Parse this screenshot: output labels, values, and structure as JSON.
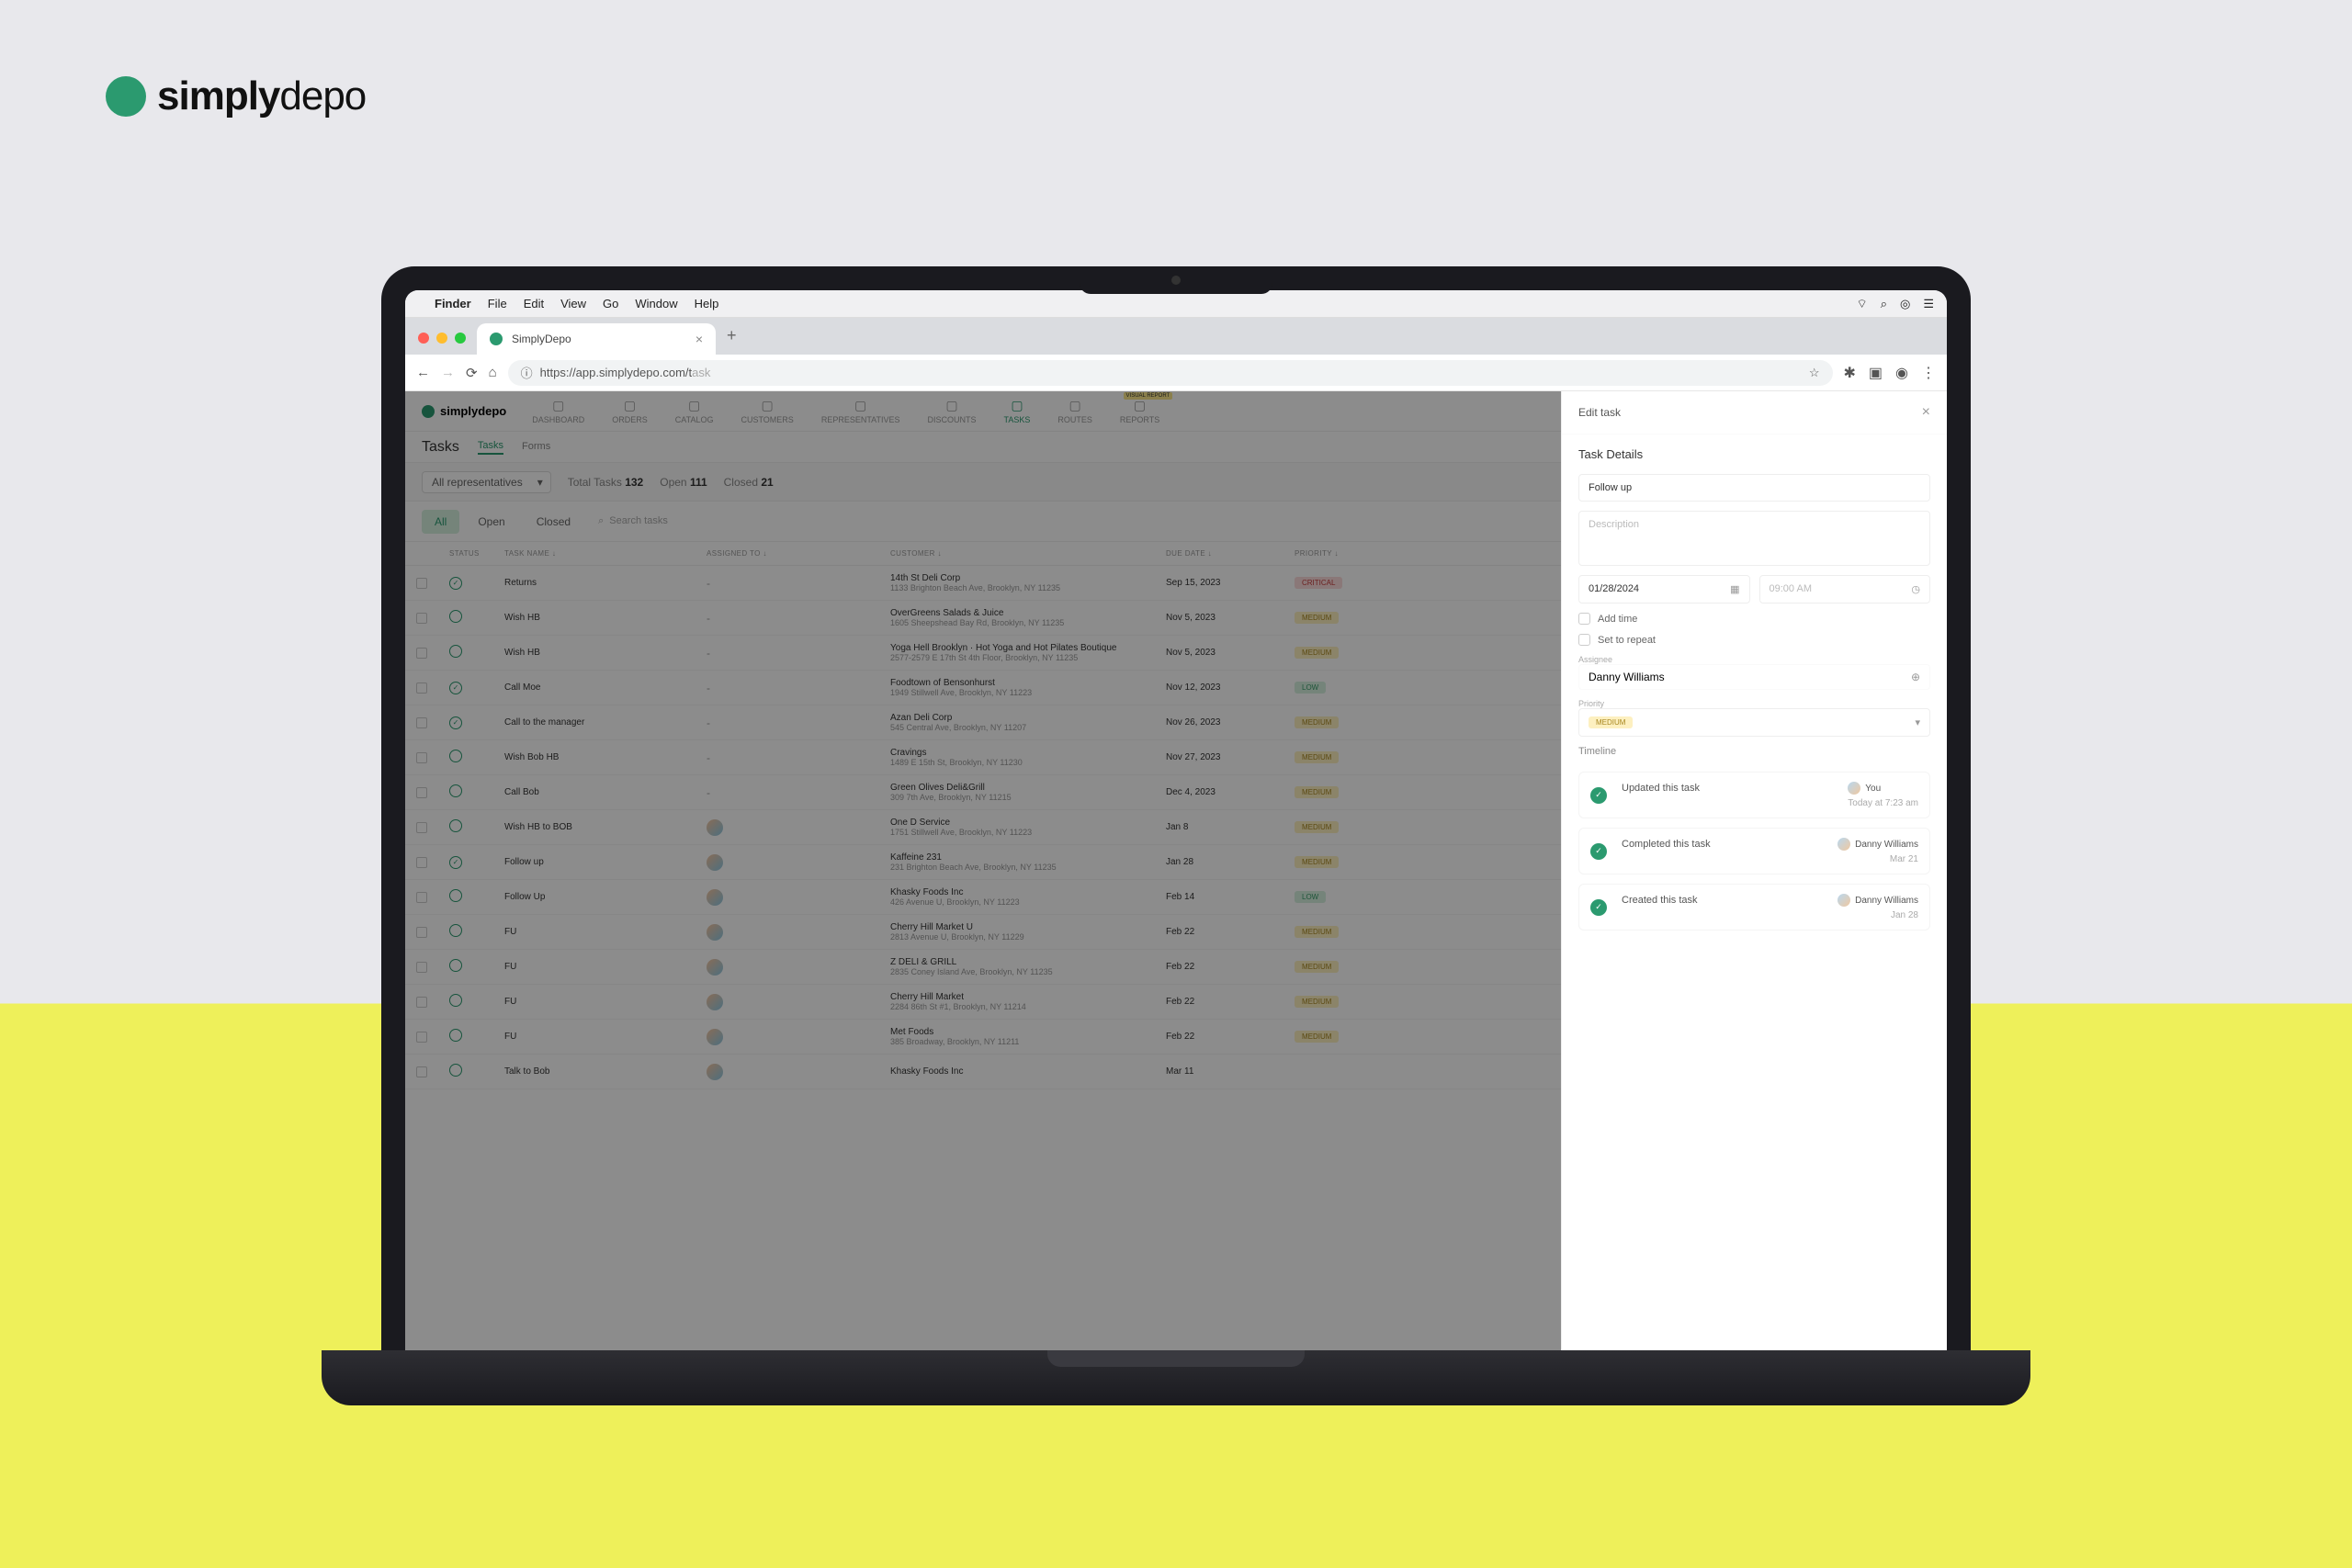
{
  "brand": {
    "text_bold": "simply",
    "text_light": "depo"
  },
  "mac_menubar": {
    "items": [
      "Finder",
      "File",
      "Edit",
      "View",
      "Go",
      "Window",
      "Help"
    ]
  },
  "chrome": {
    "tab_title": "SimplyDepo",
    "url_display": "https://app.simplydepo.com/t",
    "url_grey": "ask"
  },
  "app": {
    "nav": [
      {
        "label": "DASHBOARD",
        "active": false
      },
      {
        "label": "ORDERS",
        "active": false
      },
      {
        "label": "CATALOG",
        "active": false
      },
      {
        "label": "CUSTOMERS",
        "active": false
      },
      {
        "label": "REPRESENTATIVES",
        "active": false
      },
      {
        "label": "DISCOUNTS",
        "active": false
      },
      {
        "label": "TASKS",
        "active": true
      },
      {
        "label": "ROUTES",
        "active": false
      },
      {
        "label": "REPORTS",
        "active": false,
        "badge": "VISUAL REPORT"
      }
    ],
    "page_title": "Tasks",
    "subtabs": [
      "Tasks",
      "Forms"
    ],
    "subtab_active": 0,
    "filters": {
      "rep_select": "All representatives",
      "total_label": "Total Tasks",
      "total_value": "132",
      "open_label": "Open",
      "open_value": "111",
      "closed_label": "Closed",
      "closed_value": "21"
    },
    "toolbar": {
      "tabs": [
        "All",
        "Open",
        "Closed"
      ],
      "active": 0,
      "search_placeholder": "Search tasks"
    },
    "columns": [
      "",
      "STATUS",
      "TASK NAME ↓",
      "ASSIGNED TO ↓",
      "CUSTOMER ↓",
      "DUE DATE ↓",
      "PRIORITY ↓"
    ],
    "rows": [
      {
        "status_done": true,
        "task": "Returns",
        "assigned": "-",
        "customer": "14th St Deli Corp",
        "addr": "1133 Brighton Beach Ave, Brooklyn, NY 11235",
        "due": "Sep 15, 2023",
        "priority": "CRITICAL",
        "pc": "critical"
      },
      {
        "status_done": false,
        "task": "Wish HB",
        "assigned": "-",
        "customer": "OverGreens Salads & Juice",
        "addr": "1605 Sheepshead Bay Rd, Brooklyn, NY 11235",
        "due": "Nov 5, 2023",
        "priority": "MEDIUM",
        "pc": "medium"
      },
      {
        "status_done": false,
        "task": "Wish HB",
        "assigned": "-",
        "customer": "Yoga Hell Brooklyn · Hot Yoga and Hot Pilates Boutique",
        "addr": "2577-2579 E 17th St 4th Floor, Brooklyn, NY 11235",
        "due": "Nov 5, 2023",
        "priority": "MEDIUM",
        "pc": "medium"
      },
      {
        "status_done": true,
        "task": "Call Moe",
        "assigned": "-",
        "customer": "Foodtown of Bensonhurst",
        "addr": "1949 Stillwell Ave, Brooklyn, NY 11223",
        "due": "Nov 12, 2023",
        "priority": "LOW",
        "pc": "low"
      },
      {
        "status_done": true,
        "task": "Call to the manager",
        "assigned": "-",
        "customer": "Azan Deli Corp",
        "addr": "545 Central Ave, Brooklyn, NY 11207",
        "due": "Nov 26, 2023",
        "priority": "MEDIUM",
        "pc": "medium"
      },
      {
        "status_done": false,
        "task": "Wish Bob HB",
        "assigned": "-",
        "customer": "Cravings",
        "addr": "1489 E 15th St, Brooklyn, NY 11230",
        "due": "Nov 27, 2023",
        "priority": "MEDIUM",
        "pc": "medium"
      },
      {
        "status_done": false,
        "task": "Call Bob",
        "assigned": "-",
        "customer": "Green Olives Deli&Grill",
        "addr": "309 7th Ave, Brooklyn, NY 11215",
        "due": "Dec 4, 2023",
        "priority": "MEDIUM",
        "pc": "medium"
      },
      {
        "status_done": false,
        "task": "Wish HB to BOB",
        "assigned": "avatar",
        "customer": "One D Service",
        "addr": "1751 Stillwell Ave, Brooklyn, NY 11223",
        "due": "Jan 8",
        "priority": "MEDIUM",
        "pc": "medium"
      },
      {
        "status_done": true,
        "task": "Follow up",
        "assigned": "avatar",
        "customer": "Kaffeine 231",
        "addr": "231 Brighton Beach Ave, Brooklyn, NY 11235",
        "due": "Jan 28",
        "priority": "MEDIUM",
        "pc": "medium"
      },
      {
        "status_done": false,
        "task": "Follow Up",
        "assigned": "avatar",
        "customer": "Khasky Foods Inc",
        "addr": "426 Avenue U, Brooklyn, NY 11223",
        "due": "Feb 14",
        "priority": "LOW",
        "pc": "low"
      },
      {
        "status_done": false,
        "task": "FU",
        "assigned": "avatar",
        "customer": "Cherry Hill Market U",
        "addr": "2813 Avenue U, Brooklyn, NY 11229",
        "due": "Feb 22",
        "priority": "MEDIUM",
        "pc": "medium"
      },
      {
        "status_done": false,
        "task": "FU",
        "assigned": "avatar",
        "customer": "Z DELI & GRILL",
        "addr": "2835 Coney Island Ave, Brooklyn, NY 11235",
        "due": "Feb 22",
        "priority": "MEDIUM",
        "pc": "medium"
      },
      {
        "status_done": false,
        "task": "FU",
        "assigned": "avatar",
        "customer": "Cherry Hill Market",
        "addr": "2284 86th St #1, Brooklyn, NY 11214",
        "due": "Feb 22",
        "priority": "MEDIUM",
        "pc": "medium"
      },
      {
        "status_done": false,
        "task": "FU",
        "assigned": "avatar",
        "customer": "Met Foods",
        "addr": "385 Broadway, Brooklyn, NY 11211",
        "due": "Feb 22",
        "priority": "MEDIUM",
        "pc": "medium"
      },
      {
        "status_done": false,
        "task": "Talk to Bob",
        "assigned": "avatar",
        "customer": "Khasky Foods Inc",
        "addr": "",
        "due": "Mar 11",
        "priority": "",
        "pc": ""
      }
    ]
  },
  "panel": {
    "title": "Edit task",
    "section_title": "Task Details",
    "task_name": "Follow up",
    "description_placeholder": "Description",
    "date_value": "01/28/2024",
    "time_value": "09:00 AM",
    "add_time_label": "Add time",
    "repeat_label": "Set to repeat",
    "assignee_label": "Assignee",
    "assignee_value": "Danny Williams",
    "priority_label": "Priority",
    "priority_value": "MEDIUM",
    "timeline_label": "Timeline",
    "timeline": [
      {
        "action": "Updated this task",
        "user": "You",
        "time": "Today at 7:23 am"
      },
      {
        "action": "Completed this task",
        "user": "Danny Williams",
        "time": "Mar 21"
      },
      {
        "action": "Created this task",
        "user": "Danny Williams",
        "time": "Jan 28"
      }
    ]
  }
}
